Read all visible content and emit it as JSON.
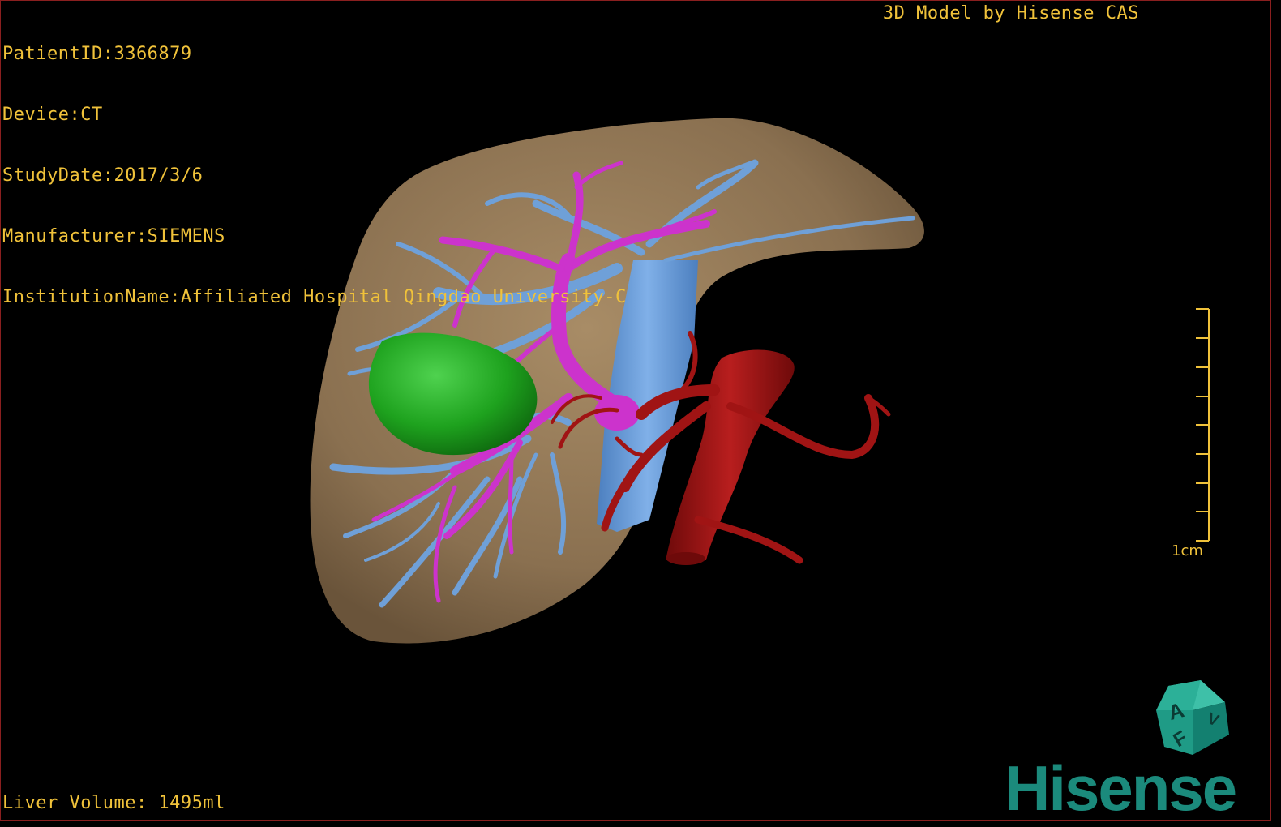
{
  "patient_info": {
    "patient_id": "PatientID:3366879",
    "device": "Device:CT",
    "study_date": "StudyDate:2017/3/6",
    "manufacturer": "Manufacturer:SIEMENS",
    "institution": "InstitutionName:Affiliated Hospital Qingdao University-C"
  },
  "credit": "3D Model by Hisense CAS",
  "liver_volume": "Liver Volume: 1495ml",
  "scale_bar": {
    "label": "1cm",
    "tick_count": 9
  },
  "orientation_cube": {
    "face_front": "A",
    "face_bottom": "F",
    "face_right": "V"
  },
  "logo_text": "Hisense",
  "colors": {
    "overlay_text": "#f0c23a",
    "liver": "#8a7050",
    "portal_vein": "#6fa0d8",
    "hepatic_vein": "#cc33cc",
    "gallbladder": "#1ea21e",
    "artery": "#a01414",
    "logo": "#1b8a7c"
  }
}
